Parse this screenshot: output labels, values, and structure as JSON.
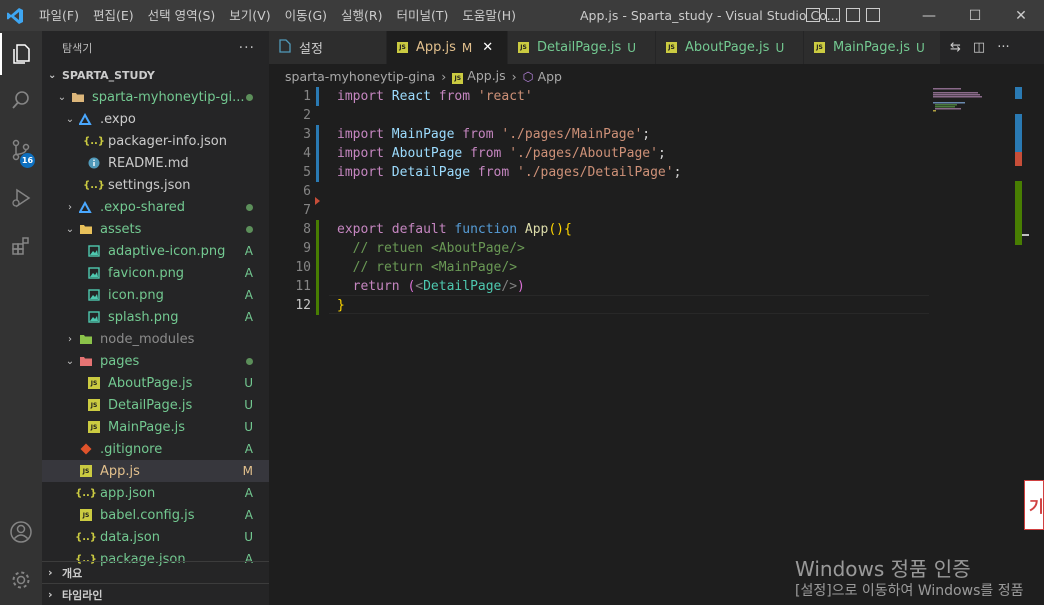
{
  "window": {
    "title": "App.js - Sparta_study - Visual Studio Co...",
    "menu": [
      "파일(F)",
      "편집(E)",
      "선택 영역(S)",
      "보기(V)",
      "이동(G)",
      "실행(R)",
      "터미널(T)",
      "도움말(H)"
    ],
    "controls": {
      "minimize": "—",
      "maximize": "☐",
      "close": "✕"
    }
  },
  "activity": {
    "source_control_badge": "16"
  },
  "sidebar": {
    "header": "탐색기",
    "more": "···",
    "root": "SPARTA_STUDY",
    "tree": [
      {
        "label": "sparta-myhoneytip-gi...",
        "chevron": "⌄",
        "icon": "folder",
        "status": "dot",
        "indent": 1,
        "color": "green"
      },
      {
        "label": ".expo",
        "chevron": "⌄",
        "icon": "expo",
        "status": "",
        "indent": 2,
        "color": "default"
      },
      {
        "label": "packager-info.json",
        "chevron": "",
        "icon": "json",
        "status": "",
        "indent": 3,
        "color": "default"
      },
      {
        "label": "README.md",
        "chevron": "",
        "icon": "info",
        "status": "",
        "indent": 3,
        "color": "default"
      },
      {
        "label": "settings.json",
        "chevron": "",
        "icon": "json",
        "status": "",
        "indent": 3,
        "color": "default"
      },
      {
        "label": ".expo-shared",
        "chevron": "›",
        "icon": "expo",
        "status": "dot",
        "indent": 2,
        "color": "green"
      },
      {
        "label": "assets",
        "chevron": "⌄",
        "icon": "folder-yellow",
        "status": "dot",
        "indent": 2,
        "color": "green"
      },
      {
        "label": "adaptive-icon.png",
        "chevron": "",
        "icon": "png",
        "status": "A",
        "indent": 3,
        "color": "green"
      },
      {
        "label": "favicon.png",
        "chevron": "",
        "icon": "png",
        "status": "A",
        "indent": 3,
        "color": "green"
      },
      {
        "label": "icon.png",
        "chevron": "",
        "icon": "png",
        "status": "A",
        "indent": 3,
        "color": "green"
      },
      {
        "label": "splash.png",
        "chevron": "",
        "icon": "png",
        "status": "A",
        "indent": 3,
        "color": "green"
      },
      {
        "label": "node_modules",
        "chevron": "›",
        "icon": "folder-green",
        "status": "",
        "indent": 2,
        "color": "dim"
      },
      {
        "label": "pages",
        "chevron": "⌄",
        "icon": "folder-red",
        "status": "dot",
        "indent": 2,
        "color": "green"
      },
      {
        "label": "AboutPage.js",
        "chevron": "",
        "icon": "js",
        "status": "U",
        "indent": 3,
        "color": "green"
      },
      {
        "label": "DetailPage.js",
        "chevron": "",
        "icon": "js",
        "status": "U",
        "indent": 3,
        "color": "green"
      },
      {
        "label": "MainPage.js",
        "chevron": "",
        "icon": "js",
        "status": "U",
        "indent": 3,
        "color": "green"
      },
      {
        "label": ".gitignore",
        "chevron": "",
        "icon": "git",
        "status": "A",
        "indent": 2,
        "color": "green"
      },
      {
        "label": "App.js",
        "chevron": "",
        "icon": "js",
        "status": "M",
        "indent": 2,
        "color": "yellow",
        "selected": true
      },
      {
        "label": "app.json",
        "chevron": "",
        "icon": "json",
        "status": "A",
        "indent": 2,
        "color": "green"
      },
      {
        "label": "babel.config.js",
        "chevron": "",
        "icon": "js",
        "status": "A",
        "indent": 2,
        "color": "green"
      },
      {
        "label": "data.json",
        "chevron": "",
        "icon": "json",
        "status": "U",
        "indent": 2,
        "color": "green"
      },
      {
        "label": "package.json",
        "chevron": "",
        "icon": "json",
        "status": "A",
        "indent": 2,
        "color": "green"
      }
    ],
    "outline": "개요",
    "timeline": "타임라인"
  },
  "tabs": [
    {
      "label": "설정",
      "icon": "settings",
      "mark": "",
      "active": false
    },
    {
      "label": "App.js",
      "icon": "js",
      "mark": "M",
      "active": true
    },
    {
      "label": "DetailPage.js",
      "icon": "js",
      "mark": "U",
      "active": false
    },
    {
      "label": "AboutPage.js",
      "icon": "js",
      "mark": "U",
      "active": false
    },
    {
      "label": "MainPage.js",
      "icon": "js",
      "mark": "U",
      "active": false
    }
  ],
  "breadcrumb": {
    "folder": "sparta-myhoneytip-gina",
    "file": "App.js",
    "symbol": "App"
  },
  "code": {
    "current_line": 12,
    "lines": [
      [
        [
          "kw",
          "import"
        ],
        [
          "def",
          " "
        ],
        [
          "var",
          "React"
        ],
        [
          "def",
          " "
        ],
        [
          "kw",
          "from"
        ],
        [
          "def",
          " "
        ],
        [
          "str",
          "'react'"
        ]
      ],
      [],
      [
        [
          "kw",
          "import"
        ],
        [
          "def",
          " "
        ],
        [
          "var",
          "MainPage"
        ],
        [
          "def",
          " "
        ],
        [
          "kw",
          "from"
        ],
        [
          "def",
          " "
        ],
        [
          "str",
          "'./pages/MainPage'"
        ],
        [
          "def",
          ";"
        ]
      ],
      [
        [
          "kw",
          "import"
        ],
        [
          "def",
          " "
        ],
        [
          "var",
          "AboutPage"
        ],
        [
          "def",
          " "
        ],
        [
          "kw",
          "from"
        ],
        [
          "def",
          " "
        ],
        [
          "str",
          "'./pages/AboutPage'"
        ],
        [
          "def",
          ";"
        ]
      ],
      [
        [
          "kw",
          "import"
        ],
        [
          "def",
          " "
        ],
        [
          "var",
          "DetailPage"
        ],
        [
          "def",
          " "
        ],
        [
          "kw",
          "from"
        ],
        [
          "def",
          " "
        ],
        [
          "str",
          "'./pages/DetailPage'"
        ],
        [
          "def",
          ";"
        ]
      ],
      [],
      [],
      [
        [
          "kw",
          "export"
        ],
        [
          "def",
          " "
        ],
        [
          "kw",
          "default"
        ],
        [
          "def",
          " "
        ],
        [
          "blue",
          "function"
        ],
        [
          "def",
          " "
        ],
        [
          "fn",
          "App"
        ],
        [
          "brace",
          "()"
        ],
        [
          "brace",
          "{"
        ]
      ],
      [
        [
          "def",
          "  "
        ],
        [
          "cmt",
          "// retuen <AboutPage/>"
        ]
      ],
      [
        [
          "def",
          "  "
        ],
        [
          "cmt",
          "// return <MainPage/>"
        ]
      ],
      [
        [
          "def",
          "  "
        ],
        [
          "kw",
          "return"
        ],
        [
          "def",
          " "
        ],
        [
          "paren",
          "("
        ],
        [
          "tag",
          "<"
        ],
        [
          "comp",
          "DetailPage"
        ],
        [
          "tag",
          "/>"
        ],
        [
          "paren",
          ")"
        ]
      ],
      [
        [
          "brace",
          "}"
        ]
      ]
    ]
  },
  "watermark": {
    "title": "Windows 정품 인증",
    "subtitle": "[설정]으로 이동하여 Windows를 정품"
  },
  "popup_text": "기"
}
